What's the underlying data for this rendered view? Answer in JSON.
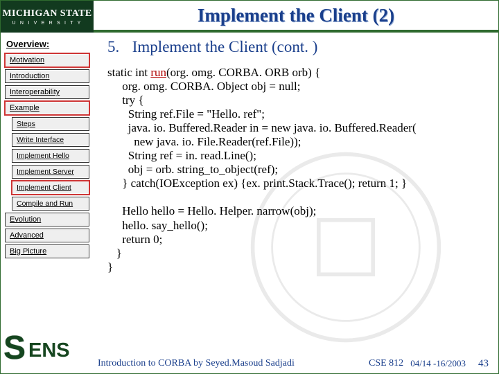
{
  "logo": {
    "line1": "MICHIGAN STATE",
    "line2": "U N I V E R S I T Y"
  },
  "title": "Implement the Client (2)",
  "sidebar": {
    "heading": "Overview:",
    "items": [
      {
        "label": "Motivation",
        "boxed": true
      },
      {
        "label": "Introduction"
      },
      {
        "label": "Interoperability"
      },
      {
        "label": "Example",
        "boxed": true
      },
      {
        "label": "Steps",
        "sub": true
      },
      {
        "label": "Write Interface",
        "sub": true
      },
      {
        "label": "Implement Hello",
        "sub": true
      },
      {
        "label": "Implement Server",
        "sub": true
      },
      {
        "label": "Implement Client",
        "sub": true,
        "boxed": true
      },
      {
        "label": "Compile and Run",
        "sub": true
      },
      {
        "label": "Evolution"
      },
      {
        "label": "Advanced"
      },
      {
        "label": "Big Picture"
      }
    ]
  },
  "content": {
    "list_number": "5.",
    "list_text": "Implement the Client (cont. )",
    "code_pre_run": "static int ",
    "code_run": "run",
    "code_post_run": "(org. omg. CORBA. ORB orb) {\n     org. omg. CORBA. Object obj = null;\n     try {\n       String ref.File = \"Hello. ref\";\n       java. io. Buffered.Reader in = new java. io. Buffered.Reader(\n         new java. io. File.Reader(ref.File));\n       String ref = in. read.Line();\n       obj = orb. string_to_object(ref);\n     } catch(IOException ex) {ex. print.Stack.Trace(); return 1; }\n\n     Hello hello = Hello. Helper. narrow(obj);\n     hello. say_hello();\n     return 0;\n   }\n}"
  },
  "footer": {
    "left": "Introduction to CORBA by Seyed.Masoud Sadjadi",
    "course": "CSE 812",
    "date": "04/14 -16/2003",
    "page": "43"
  },
  "sens": {
    "s": "S",
    "rest": "ENS"
  }
}
